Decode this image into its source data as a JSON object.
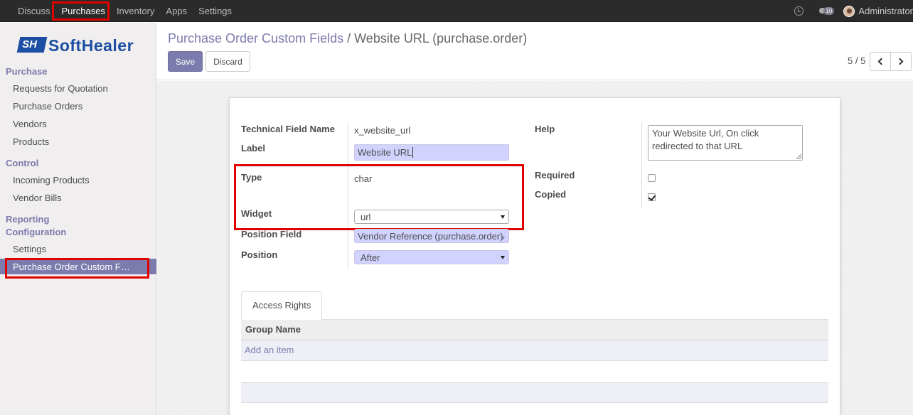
{
  "topbar": {
    "menu": [
      "Discuss",
      "Purchases",
      "Inventory",
      "Apps",
      "Settings"
    ],
    "chat_badge": "10",
    "user": "Administrator"
  },
  "sidebar": {
    "logo_mark": "SH",
    "logo_text": "SoftHealer",
    "sections": {
      "purchase": "Purchase",
      "control": "Control",
      "reporting": "Reporting",
      "configuration": "Configuration"
    },
    "purchase_items": [
      "Requests for Quotation",
      "Purchase Orders",
      "Vendors",
      "Products"
    ],
    "control_items": [
      "Incoming Products",
      "Vendor Bills"
    ],
    "config_items": [
      "Settings",
      "Purchase Order Custom F…"
    ]
  },
  "control_panel": {
    "breadcrumb_parent": "Purchase Order Custom Fields",
    "breadcrumb_sep": "/",
    "breadcrumb_current": "Website URL (purchase.order)",
    "save_label": "Save",
    "discard_label": "Discard",
    "pager": "5 / 5"
  },
  "form": {
    "tech_name_label": "Technical Field Name",
    "tech_name_value": "x_website_url",
    "label_label": "Label",
    "label_value": "Website URL",
    "type_label": "Type",
    "type_value": "char",
    "widget_label": "Widget",
    "widget_value": "url",
    "position_field_label": "Position Field",
    "position_field_value": "Vendor Reference (purchase.order)",
    "position_label": "Position",
    "position_value": "After",
    "help_label": "Help",
    "help_value": "Your Website Url, On click redirected to that URL",
    "required_label": "Required",
    "required_checked": false,
    "copied_label": "Copied",
    "copied_checked": true
  },
  "tabs": {
    "access_rights": "Access Rights",
    "group_name_header": "Group Name",
    "add_item": "Add an item"
  },
  "colors": {
    "accent": "#7c7bad",
    "highlight": "#e00000",
    "required_field": "#d2d2ff"
  }
}
